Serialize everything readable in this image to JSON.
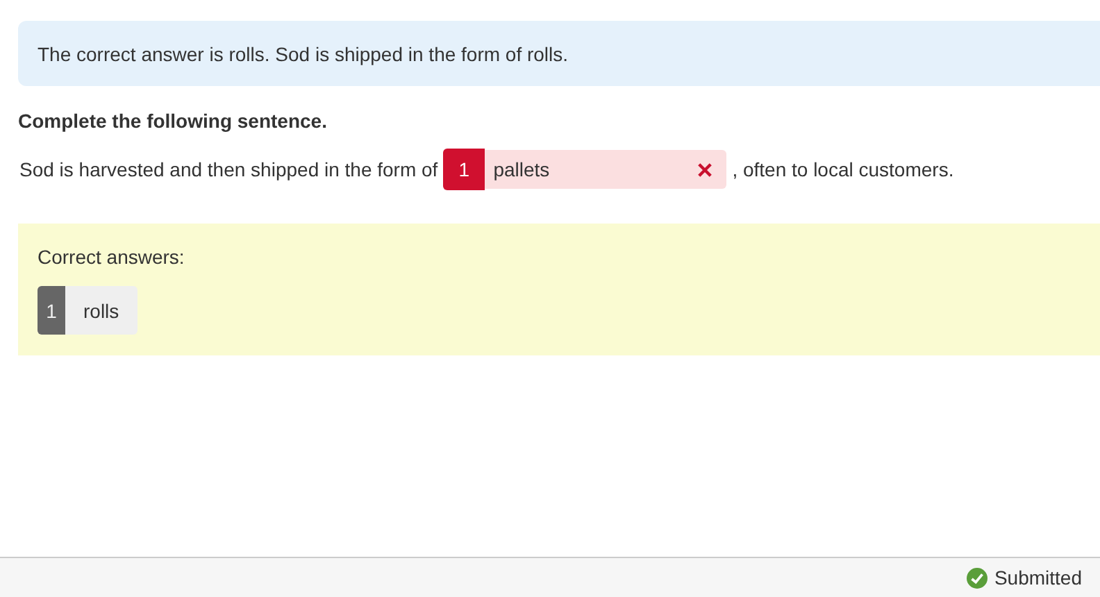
{
  "feedback": {
    "text": "The correct answer is rolls. Sod is shipped in the form of rolls."
  },
  "question": {
    "prompt": "Complete the following sentence.",
    "before": "Sod is harvested and then shipped in the form of",
    "blank": {
      "number": "1",
      "value": "pallets",
      "correct": false
    },
    "after": ", often to local customers."
  },
  "correct_answers": {
    "label": "Correct answers:",
    "items": [
      {
        "number": "1",
        "text": "rolls"
      }
    ]
  },
  "status_bar": {
    "status": "Submitted",
    "submitted": true
  }
}
